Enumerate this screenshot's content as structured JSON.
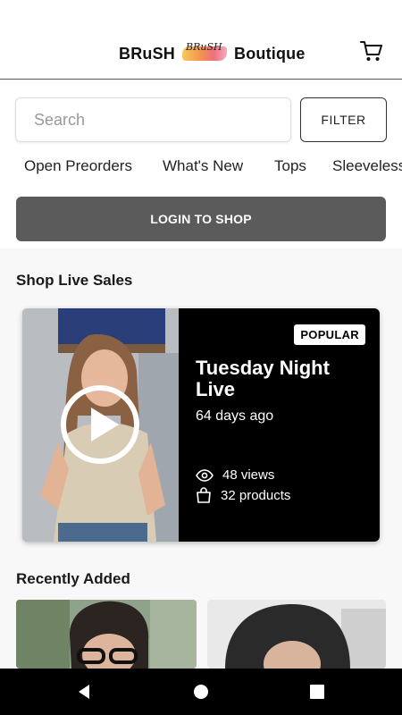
{
  "header": {
    "brand_left": "BRuSH",
    "brand_logo_text": "BRuSH",
    "brand_right": "Boutique",
    "cart_icon": "shopping-cart-icon"
  },
  "search": {
    "placeholder": "Search"
  },
  "filter_label": "FILTER",
  "categories": [
    "Open Preorders",
    "What's New",
    "Tops",
    "Sleeveless"
  ],
  "login_label": "LOGIN TO SHOP",
  "live_section": {
    "title": "Shop Live Sales",
    "card": {
      "badge": "POPULAR",
      "title": "Tuesday Night Live",
      "ago": "64 days ago",
      "views": "48 views",
      "products": "32 products",
      "play_icon": "play-icon",
      "views_icon": "eye-icon",
      "products_icon": "shopping-bag-icon"
    }
  },
  "recent_section": {
    "title": "Recently Added"
  },
  "navbar": {
    "icons": [
      "back-icon",
      "home-icon",
      "recents-icon"
    ]
  },
  "colors": {
    "login_button": "#5b5b5b",
    "card_bg": "#000000",
    "navbar": "#000000"
  }
}
